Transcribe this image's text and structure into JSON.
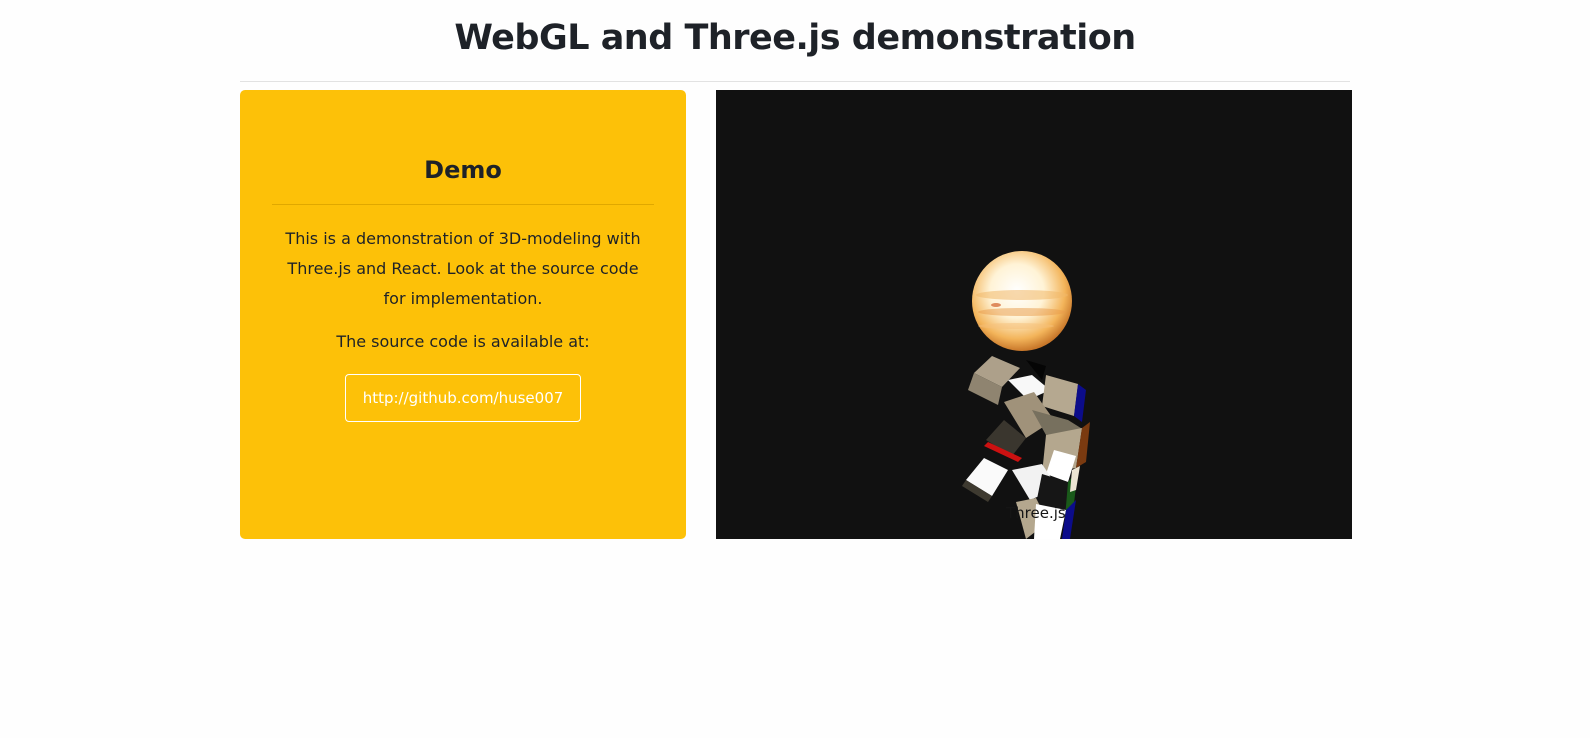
{
  "header": {
    "title": "WebGL and Three.js demonstration"
  },
  "demo_card": {
    "title": "Demo",
    "description": "This is a demonstration of 3D-modeling with Three.js and React. Look at the source code for implementation.",
    "source_label": "The source code is available at:",
    "source_link_text": "http://github.com/huse007"
  },
  "scene": {
    "label": "Three.js",
    "background_color": "#111111",
    "objects": [
      "sphere",
      "cube-cluster"
    ]
  },
  "colors": {
    "card_background": "#fdc108",
    "title_text": "#1e2228",
    "link_border": "#ffffff"
  }
}
